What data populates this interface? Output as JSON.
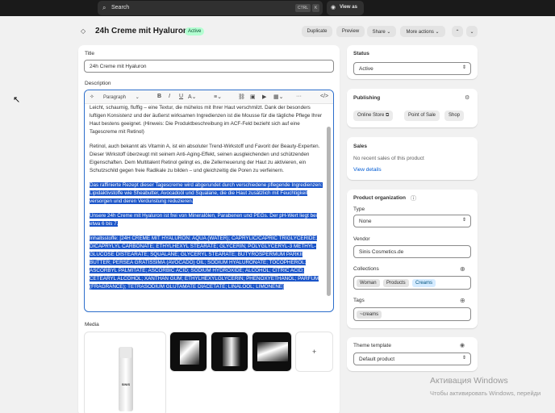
{
  "topbar": {
    "search_label": "Search",
    "shortcut_1": "CTRL",
    "shortcut_2": "K",
    "view_as": "View as"
  },
  "product": {
    "title": "24h Creme mit Hyaluron",
    "status_badge": "Active",
    "actions": [
      "Duplicate",
      "Preview",
      "Share",
      "More actions"
    ]
  },
  "form": {
    "title_label": "Title",
    "title_value": "24h Creme mit Hyaluron",
    "description_label": "Description",
    "paragraph_style": "Paragraph",
    "description_paragraphs": [
      "Leicht, schaumig, fluffig – eine Textur, die mühelos mit Ihrer Haut verschmilzt. Dank der besonders luftigen Konsistenz und der äußerst wirksamen Ingredienzen ist die Mousse für die tägliche Pflege Ihrer Haut bestens geeignet. (Hinweis: Die Produktbeschreibung im ACF-Feld bezieht sich auf eine Tagescreme mit Retinol)",
      "Retinol, auch bekannt als Vitamin A, ist ein absoluter Trend-Wirkstoff und Favorit der Beauty-Experten. Dieser Wirkstoff überzeugt mit seinem Anti-Aging-Effekt, seinen ausgleichenden und schützenden Eigenschaften. Dem Multitalent Retinol gelingt es, die Zellerneuerung der Haut zu aktivieren, ein Schutzschild gegen freie Radikale zu bilden – und gleichzeitig die Poren zu verfeinern."
    ],
    "selected_paragraphs": [
      "Das raffinierte Rezept dieser Tagescreme wird abgerundet durch verschiedene pflegende Ingredienzen: Lipidaktivstoffe wie Sheabutter, Avocadoöl und Squalane, die die Haut zusätzlich mit Feuchtigkeit versorgen und deren Verdunstung reduzieren.",
      "Unsere 24h Creme mit Hyaluron ist frei von Mineralölen, Parabenen und PEGs. Der pH-Wert liegt bei etwa 6 bis 7.",
      "Inhaltsstoffe: [24H CREME MIT HYALURON: AQUA (WATER); CAPRYLIC/CAPRIC TRIGLYCERIDE; DICAPRYLYL CARBONATE; ETHYLHEXYL STEARATE; GLYCERIN; POLYGLYCERYL-3 METHYL-GLUCOSE DISTEARATE; SQUALANE; GLYCERYL STEARATE; BUTYROSPERMUM PARKII BUTTER; PERSEA GRATISSIMA (AVOCADO) OIL; SODIUM HYALURONATE; TOCOPHEROL; ASCORBYL PALMITATE; ASCORBIC ACID; SODIUM HYDROXIDE; ALCOHOL; CITRIC ACID; CETEARYL ALCOHOL; XANTHAN GUM; ETHYLHEXYLGLYCERIN; PHENOXYETHANOL; PARFUM (FRAGRANCE); TETRASODIUM GLUTAMATE DIACETATE; LINALOOL; LIMONENE]"
    ],
    "media_label": "Media",
    "add_media": "+",
    "bottle_brand": "SINIS"
  },
  "sidebar": {
    "status": {
      "title": "Status",
      "value": "Active"
    },
    "publishing": {
      "title": "Publishing",
      "channels": [
        "Online Store",
        "Point of Sale",
        "Shop"
      ]
    },
    "sales": {
      "title": "Sales",
      "message": "No recent sales of this product",
      "link": "View details"
    },
    "organization": {
      "title": "Product organization",
      "type_label": "Type",
      "type_value": "None",
      "vendor_label": "Vendor",
      "vendor_value": "Sinis Cosmetics.de",
      "collections_label": "Collections",
      "collections": [
        "Woman",
        "Products",
        "Creams"
      ],
      "tags_label": "Tags",
      "tags": [
        "~creams"
      ]
    },
    "theme": {
      "title": "Theme template",
      "value": "Default product"
    }
  },
  "watermark": {
    "line1": "Активация Windows",
    "line2": "Чтобы активировать Windows, перейди"
  }
}
